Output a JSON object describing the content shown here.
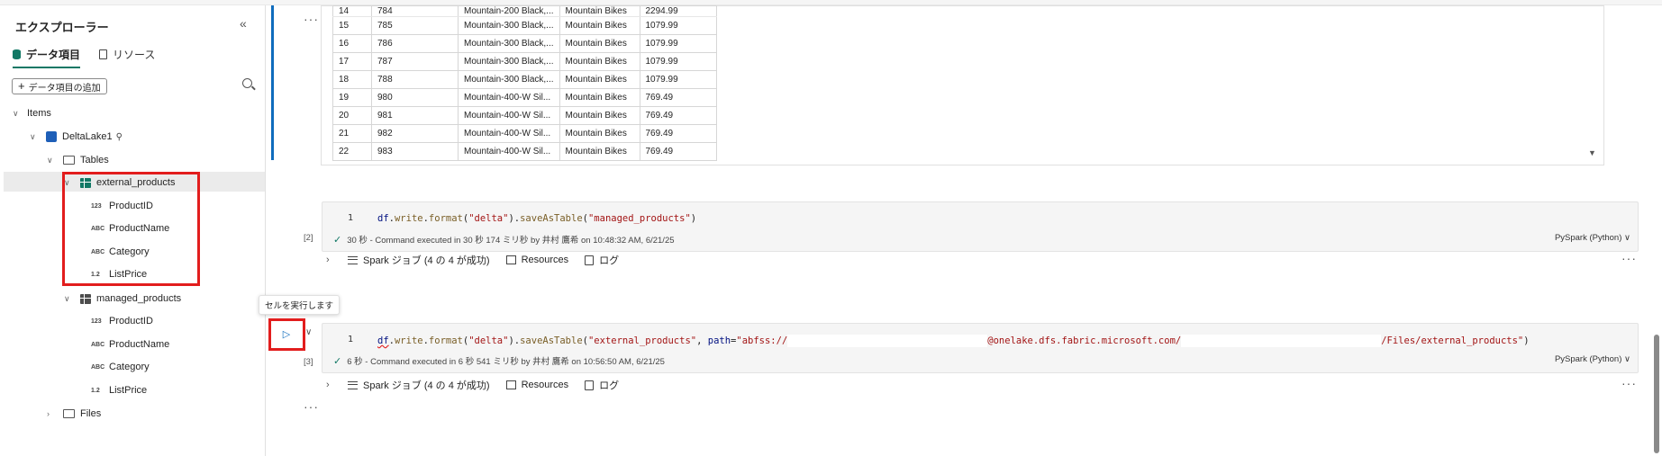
{
  "explorer": {
    "title": "エクスプローラー",
    "collapse_icon": "«",
    "tabs": [
      {
        "label": "データ項目",
        "icon": "database-icon",
        "active": true
      },
      {
        "label": "リソース",
        "icon": "document-icon",
        "active": false
      }
    ],
    "add_button": "データ項目の追加",
    "tree": {
      "items_label": "Items",
      "lakehouse": "DeltaLake1",
      "tables_label": "Tables",
      "tables": [
        {
          "name": "external_products",
          "columns": [
            {
              "type": "123",
              "name": "ProductID"
            },
            {
              "type": "ABC",
              "name": "ProductName"
            },
            {
              "type": "ABC",
              "name": "Category"
            },
            {
              "type": "1.2",
              "name": "ListPrice"
            }
          ]
        },
        {
          "name": "managed_products",
          "columns": [
            {
              "type": "123",
              "name": "ProductID"
            },
            {
              "type": "ABC",
              "name": "ProductName"
            },
            {
              "type": "ABC",
              "name": "Category"
            },
            {
              "type": "1.2",
              "name": "ListPrice"
            }
          ]
        }
      ],
      "files_label": "Files"
    }
  },
  "output_table": {
    "rows": [
      [
        "14",
        "784",
        "Mountain-200 Black,...",
        "Mountain Bikes",
        "2294.99"
      ],
      [
        "15",
        "785",
        "Mountain-300 Black,...",
        "Mountain Bikes",
        "1079.99"
      ],
      [
        "16",
        "786",
        "Mountain-300 Black,...",
        "Mountain Bikes",
        "1079.99"
      ],
      [
        "17",
        "787",
        "Mountain-300 Black,...",
        "Mountain Bikes",
        "1079.99"
      ],
      [
        "18",
        "788",
        "Mountain-300 Black,...",
        "Mountain Bikes",
        "1079.99"
      ],
      [
        "19",
        "980",
        "Mountain-400-W Sil...",
        "Mountain Bikes",
        "769.49"
      ],
      [
        "20",
        "981",
        "Mountain-400-W Sil...",
        "Mountain Bikes",
        "769.49"
      ],
      [
        "21",
        "982",
        "Mountain-400-W Sil...",
        "Mountain Bikes",
        "769.49"
      ],
      [
        "22",
        "983",
        "Mountain-400-W Sil...",
        "Mountain Bikes",
        "769.49"
      ]
    ]
  },
  "cells": [
    {
      "line_no": "1",
      "code": {
        "var": "df",
        "dot1": ".",
        "fn1": "write",
        "dot2": ".",
        "fn2": "format",
        "p1": "(",
        "s1": "\"delta\"",
        "p2": ").",
        "fn3": "saveAsTable",
        "p3": "(",
        "s2": "\"managed_products\"",
        "p4": ")"
      },
      "exec_count": "[2]",
      "status": "30 秒 - Command executed in 30 秒 174 ミリ秒 by 井村 鷹希 on 10:48:32 AM, 6/21/25",
      "language": "PySpark (Python)",
      "spark_jobs": "Spark ジョブ (4 の 4 が成功)",
      "resources": "Resources",
      "log": "ログ"
    },
    {
      "line_no": "1",
      "code": {
        "var": "df",
        "dot1": ".",
        "fn1": "write",
        "dot2": ".",
        "fn2": "format",
        "p1": "(",
        "s1": "\"delta\"",
        "p2": ").",
        "fn3": "saveAsTable",
        "p3": "(",
        "s2": "\"external_products\"",
        "p4": ", ",
        "kw": "path",
        "eq": "=",
        "s3a": "\"abfss://",
        "s3b": "@onelake.dfs.fabric.microsoft.com/",
        "s3c": "/Files/external_products\"",
        "p5": ")"
      },
      "exec_count": "[3]",
      "status": "6 秒 - Command executed in 6 秒 541 ミリ秒 by 井村 鷹希 on 10:56:50 AM, 6/21/25",
      "language": "PySpark (Python)",
      "spark_jobs": "Spark ジョブ (4 の 4 が成功)",
      "resources": "Resources",
      "log": "ログ"
    }
  ],
  "tooltip": "セルを実行します",
  "run_icon": "▷",
  "colors": {
    "accent": "#0f6cbd",
    "success": "#117865",
    "highlight": "#e21d1d"
  }
}
